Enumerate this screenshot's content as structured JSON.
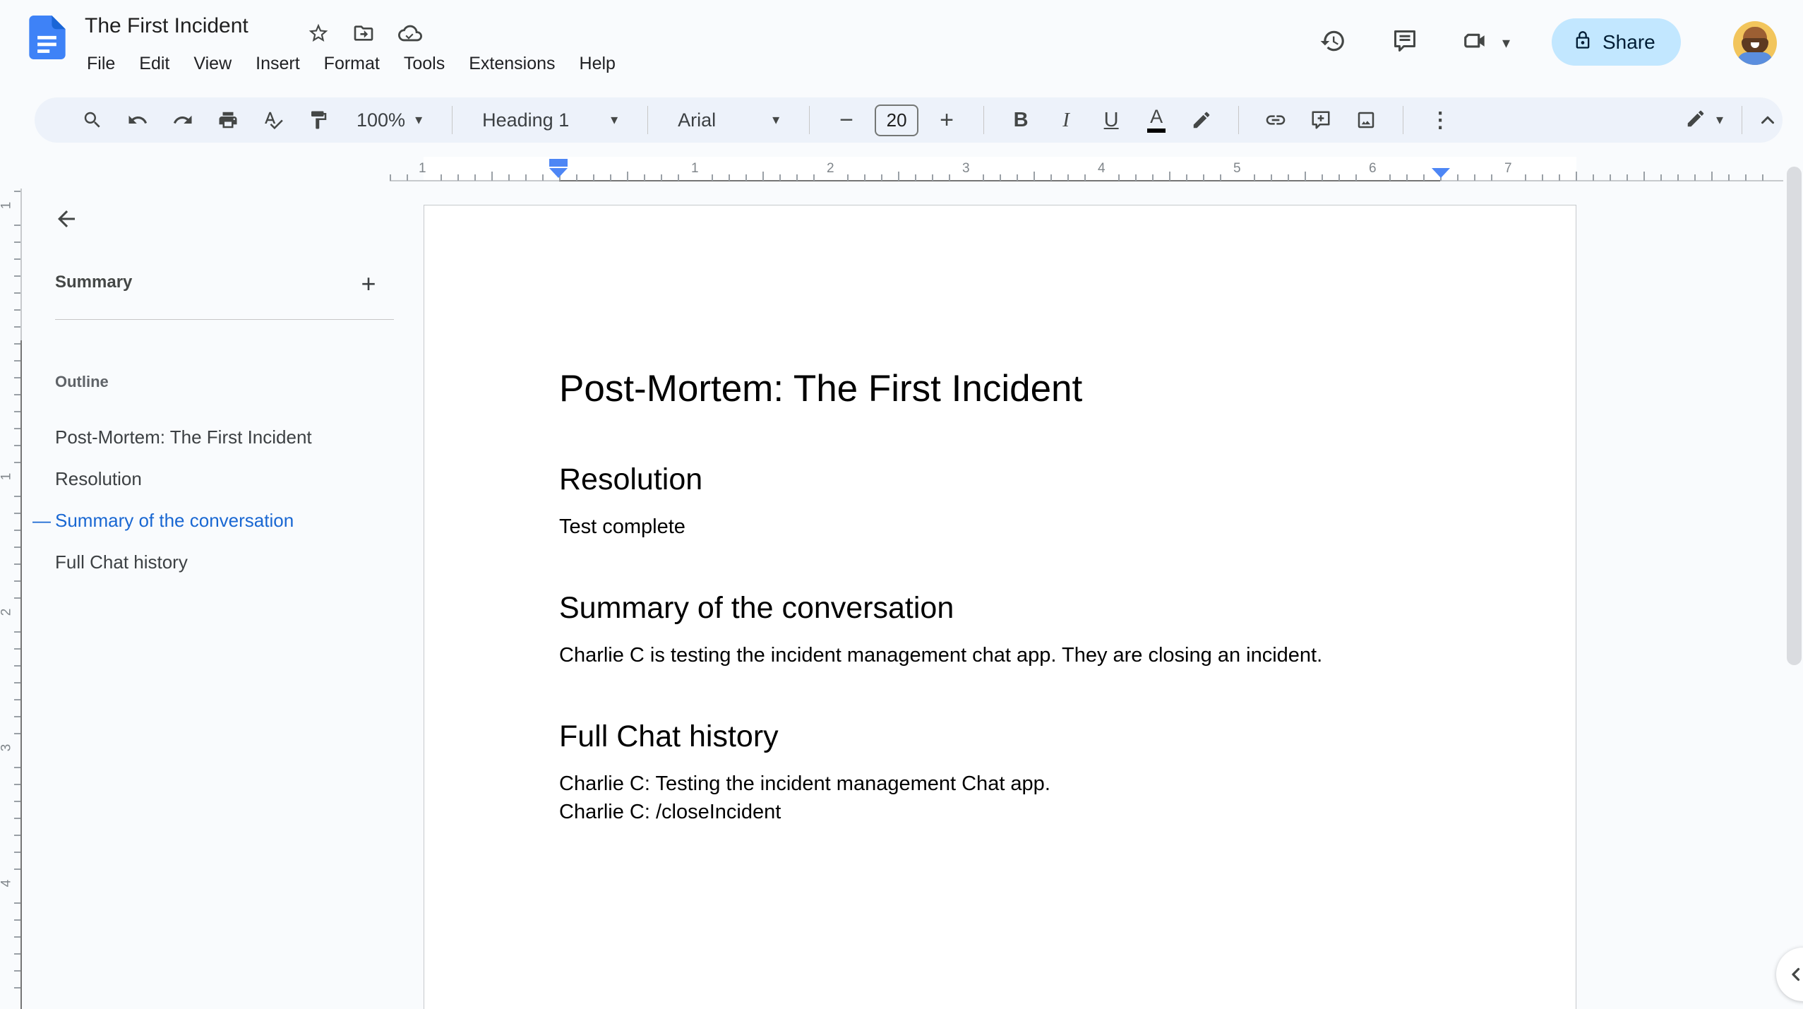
{
  "header": {
    "doc_title": "The First Incident",
    "menu_items": [
      "File",
      "Edit",
      "View",
      "Insert",
      "Format",
      "Tools",
      "Extensions",
      "Help"
    ],
    "share_label": "Share"
  },
  "toolbar": {
    "zoom_value": "100%",
    "styles_value": "Heading 1",
    "font_value": "Arial",
    "font_size_value": "20"
  },
  "ruler": {
    "horizontal_numbers": [
      "1",
      "1",
      "2",
      "3",
      "4",
      "5",
      "6",
      "7"
    ],
    "vertical_numbers": [
      "1",
      "1",
      "2",
      "3",
      "4"
    ]
  },
  "sidebar": {
    "summary_label": "Summary",
    "outline_label": "Outline",
    "outline_items": [
      {
        "label": "Post-Mortem: The First Incident",
        "active": false
      },
      {
        "label": "Resolution",
        "active": false
      },
      {
        "label": "Summary of the conversation",
        "active": true
      },
      {
        "label": "Full Chat history",
        "active": false
      }
    ]
  },
  "document": {
    "title": "Post-Mortem: The First Incident",
    "sections": [
      {
        "heading": "Resolution",
        "paragraphs": [
          "Test complete"
        ]
      },
      {
        "heading": "Summary of the conversation",
        "paragraphs": [
          "Charlie C is testing the incident management chat app. They are closing an incident."
        ]
      },
      {
        "heading": "Full Chat history",
        "paragraphs": [
          "Charlie C: Testing the incident management Chat app.",
          "Charlie C: /closeIncident"
        ]
      }
    ]
  },
  "icons": {
    "caret_down": "▾",
    "plus": "+",
    "minus": "−",
    "more_vert": "⋮",
    "bold": "B",
    "italic": "I",
    "underline": "U",
    "text_color": "A",
    "outline_active_dash": "—"
  },
  "colors": {
    "chrome_bg": "#f9fbfd",
    "toolbar_bg": "#edf2fa",
    "share_bg": "#c2e7ff",
    "share_text": "#001d35",
    "outline_active": "#1967d2",
    "docs_logo_blue": "#3e82f7",
    "indent_marker_blue": "#4d86f5",
    "icon_gray": "#444746"
  }
}
